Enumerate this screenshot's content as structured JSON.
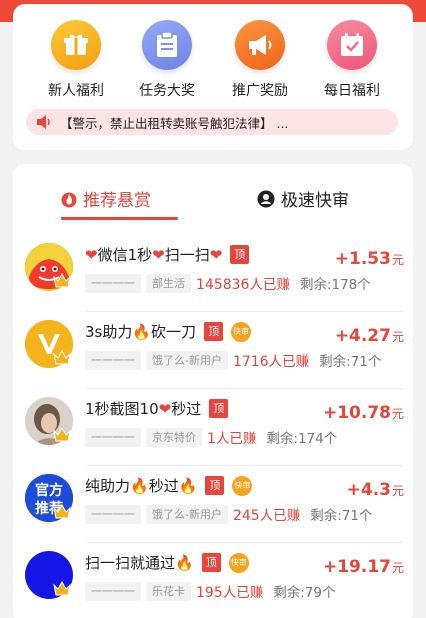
{
  "colors": {
    "accent": "#e8453c",
    "top_bar": "#ef4a38",
    "notice_bg": "#fde4e4"
  },
  "quick_entries": [
    {
      "label": "新人福利",
      "icon": "gift-box-icon",
      "color": "#f9b21c"
    },
    {
      "label": "任务大奖",
      "icon": "clipboard-icon",
      "color": "#7c93ee"
    },
    {
      "label": "推广奖励",
      "icon": "megaphone-icon",
      "color": "#f5762c"
    },
    {
      "label": "每日福利",
      "icon": "calendar-icon",
      "color": "#f36f8a"
    }
  ],
  "notice": {
    "text": "【警示，禁止出租转卖账号触犯法律】 ...",
    "icon": "speaker-icon"
  },
  "tabs": [
    {
      "label": "推荐悬赏",
      "icon": "flame-icon",
      "active": true
    },
    {
      "label": "极速快审",
      "icon": "person-icon",
      "active": false
    }
  ],
  "badges": {
    "top": "顶",
    "fast": "快审"
  },
  "tasks": [
    {
      "title_parts": [
        "❤",
        "微信1秒",
        "❤",
        "扫一扫",
        "❤"
      ],
      "badges": [
        "top"
      ],
      "user": "一一一一",
      "category": "部生活",
      "earned_count": "145836",
      "earned_suffix": "人已赚",
      "remain": "剩余:178个",
      "reward": "+1.53",
      "unit": "元"
    },
    {
      "title_parts": [
        "3s助力",
        "🔥",
        "砍一刀"
      ],
      "badges": [
        "top",
        "fast"
      ],
      "user": "一一一一",
      "category": "饿了么-新用户",
      "earned_count": "1716",
      "earned_suffix": "人已赚",
      "remain": "剩余:71个",
      "reward": "+4.27",
      "unit": "元"
    },
    {
      "title_parts": [
        "1秒截图10",
        "❤",
        "秒过"
      ],
      "badges": [
        "top"
      ],
      "user": "一一一一",
      "category": "京东特价",
      "earned_count": "1",
      "earned_suffix": "人已赚",
      "remain": "剩余:174个",
      "reward": "+10.78",
      "unit": "元"
    },
    {
      "title_parts": [
        "纯助力",
        "🔥",
        "秒过",
        "🔥"
      ],
      "badges": [
        "top",
        "fast"
      ],
      "user": "一一一一",
      "category": "饿了么-新用户",
      "earned_count": "245",
      "earned_suffix": "人已赚",
      "remain": "剩余:71个",
      "reward": "+4.3",
      "unit": "元",
      "avatar_text": [
        "官方",
        "推荐"
      ]
    },
    {
      "title_parts": [
        "扫一扫就通过",
        "🔥"
      ],
      "badges": [
        "top",
        "fast"
      ],
      "user": "一一一一",
      "category": "乐花卡",
      "earned_count": "195",
      "earned_suffix": "人已赚",
      "remain": "剩余:79个",
      "reward": "+19.17",
      "unit": "元"
    }
  ]
}
